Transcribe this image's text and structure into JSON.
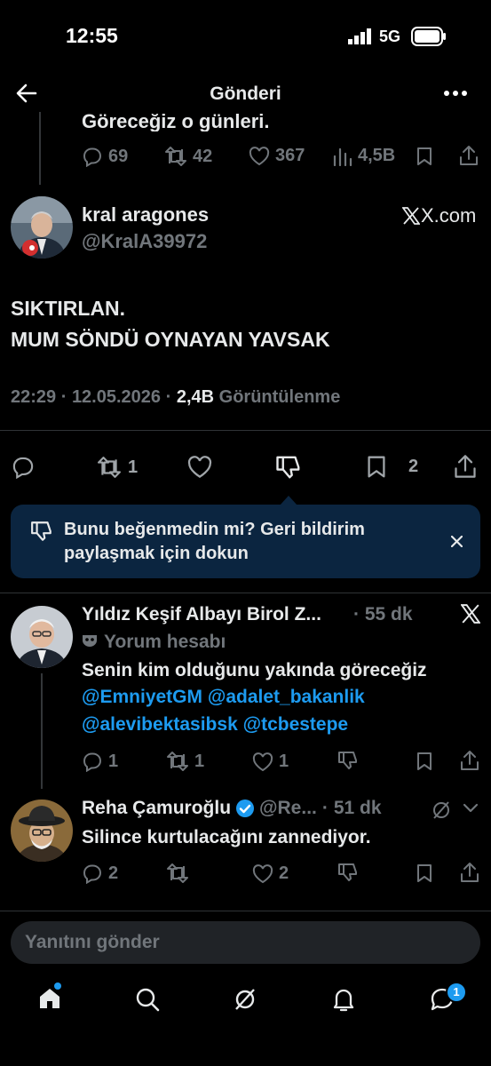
{
  "status_bar": {
    "time": "12:55",
    "network": "5G"
  },
  "header": {
    "title": "Gönderi"
  },
  "prev_tweet": {
    "text_tail": "Göreceğiz o günleri.",
    "replies": "69",
    "retweets": "42",
    "likes": "367",
    "views": "4,5B"
  },
  "main_tweet": {
    "name": "kral aragones",
    "handle": "@KralA39972",
    "source_logo": "X.com",
    "line1": "SIKTIRLAN.",
    "line2": "MUM SÖNDÜ OYNAYAN YAVSAK",
    "time": "22:29",
    "date": "12.05.2026",
    "views": "2,4B",
    "views_label": "Görüntülenme",
    "retweets": "1",
    "bookmarks": "2"
  },
  "feedback_banner": {
    "line1": "Bunu beğenmedin mi? Geri bildirim",
    "line2": "paylaşmak için dokun"
  },
  "reply1": {
    "name": "Yıldız Keşif Albayı Birol Z...",
    "time": "55 dk",
    "badge": "Yorum hesabı",
    "text": "Senin kim olduğunu yakında göreceğiz",
    "mentions_line1": [
      "@EmniyetGM",
      "@adalet_bakanlik"
    ],
    "mentions_line2": [
      "@alevibektasibsk",
      "@tcbestepe"
    ],
    "replies": "1",
    "retweets": "1",
    "likes": "1"
  },
  "reply2": {
    "name": "Reha Çamuroğlu",
    "handle": "@Re...",
    "time": "51 dk",
    "text": "Silince kurtulacağını zannediyor.",
    "replies": "2",
    "likes": "2"
  },
  "composer": {
    "placeholder": "Yanıtını gönder"
  },
  "tabbar": {
    "messages_badge": "1"
  },
  "colors": {
    "accent": "#1d9bf0",
    "banner_bg": "#0b2540",
    "muted": "#71767b"
  }
}
